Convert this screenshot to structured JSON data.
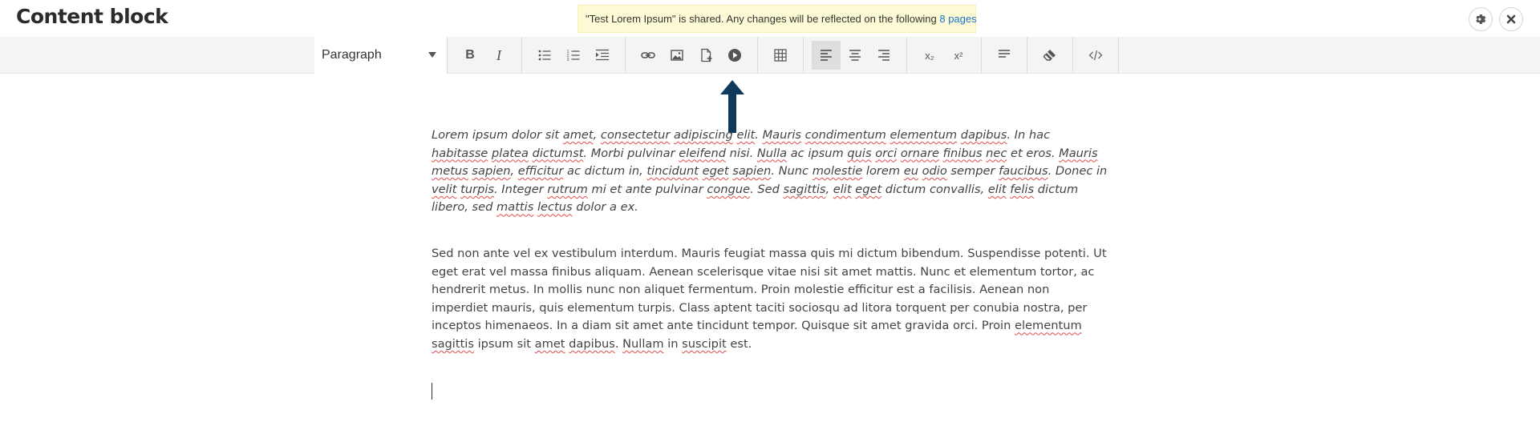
{
  "page": {
    "title": "Content block"
  },
  "notice": {
    "text": "\"Test Lorem Ipsum\" is shared. Any changes will be reflected on the following",
    "link": "8 pages"
  },
  "header_actions": {
    "settings_icon": "gear-icon",
    "close_icon": "close-icon"
  },
  "toolbar": {
    "block_format": "Paragraph",
    "bold_label": "B",
    "italic_label": "I",
    "subscript_label": "x₂",
    "superscript_label": "x²",
    "buttons": [
      "bold",
      "italic",
      "bullet-list",
      "numbered-list",
      "indent",
      "link",
      "image",
      "insert-file",
      "media",
      "table",
      "align-left",
      "align-center",
      "align-right",
      "subscript",
      "superscript",
      "paragraph",
      "clear-format",
      "source-code"
    ],
    "active_button": "align-left"
  },
  "colors": {
    "notice_bg": "#fdfbd5",
    "link": "#1a73c7",
    "arrow": "#0d3a5c",
    "spell_error": "#e14b4b"
  },
  "content": {
    "p1": [
      {
        "t": "Lorem ipsum dolor sit "
      },
      {
        "t": "amet",
        "s": 1
      },
      {
        "t": ", "
      },
      {
        "t": "consectetur",
        "s": 1
      },
      {
        "t": " "
      },
      {
        "t": "adipiscing",
        "s": 1
      },
      {
        "t": " "
      },
      {
        "t": "elit",
        "s": 1
      },
      {
        "t": ". "
      },
      {
        "t": "Mauris",
        "s": 1
      },
      {
        "t": " "
      },
      {
        "t": "condimentum",
        "s": 1
      },
      {
        "t": " "
      },
      {
        "t": "elementum",
        "s": 1
      },
      {
        "t": " "
      },
      {
        "t": "dapibus",
        "s": 1
      },
      {
        "t": ". In hac "
      },
      {
        "t": "habitasse",
        "s": 1
      },
      {
        "t": " "
      },
      {
        "t": "platea",
        "s": 1
      },
      {
        "t": " "
      },
      {
        "t": "dictumst",
        "s": 1
      },
      {
        "t": ". Morbi pulvinar "
      },
      {
        "t": "eleifend",
        "s": 1
      },
      {
        "t": " nisi. "
      },
      {
        "t": "Nulla",
        "s": 1
      },
      {
        "t": " ac ipsum "
      },
      {
        "t": "quis",
        "s": 1
      },
      {
        "t": " "
      },
      {
        "t": "orci",
        "s": 1
      },
      {
        "t": " "
      },
      {
        "t": "ornare",
        "s": 1
      },
      {
        "t": " "
      },
      {
        "t": "finibus",
        "s": 1
      },
      {
        "t": " "
      },
      {
        "t": "nec",
        "s": 1
      },
      {
        "t": " et eros. "
      },
      {
        "t": "Mauris",
        "s": 1
      },
      {
        "t": " "
      },
      {
        "t": "metus",
        "s": 1
      },
      {
        "t": " "
      },
      {
        "t": "sapien",
        "s": 1
      },
      {
        "t": ", "
      },
      {
        "t": "efficitur",
        "s": 1
      },
      {
        "t": " ac dictum in, "
      },
      {
        "t": "tincidunt",
        "s": 1
      },
      {
        "t": " "
      },
      {
        "t": "eget",
        "s": 1
      },
      {
        "t": " "
      },
      {
        "t": "sapien",
        "s": 1
      },
      {
        "t": ". Nunc "
      },
      {
        "t": "molestie",
        "s": 1
      },
      {
        "t": " lorem "
      },
      {
        "t": "eu",
        "s": 1
      },
      {
        "t": " "
      },
      {
        "t": "odio",
        "s": 1
      },
      {
        "t": " semper "
      },
      {
        "t": "faucibus",
        "s": 1
      },
      {
        "t": ". Donec in "
      },
      {
        "t": "velit",
        "s": 1
      },
      {
        "t": " "
      },
      {
        "t": "turpis",
        "s": 1
      },
      {
        "t": ". Integer "
      },
      {
        "t": "rutrum",
        "s": 1
      },
      {
        "t": " mi et ante pulvinar "
      },
      {
        "t": "congue",
        "s": 1
      },
      {
        "t": ". Sed "
      },
      {
        "t": "sagittis",
        "s": 1
      },
      {
        "t": ", "
      },
      {
        "t": "elit",
        "s": 1
      },
      {
        "t": " "
      },
      {
        "t": "eget",
        "s": 1
      },
      {
        "t": " dictum convallis, "
      },
      {
        "t": "elit",
        "s": 1
      },
      {
        "t": " "
      },
      {
        "t": "felis",
        "s": 1
      },
      {
        "t": " dictum libero, sed "
      },
      {
        "t": "mattis",
        "s": 1
      },
      {
        "t": " "
      },
      {
        "t": "lectus",
        "s": 1
      },
      {
        "t": " dolor a ex."
      }
    ],
    "p2": [
      {
        "t": "Sed non ante vel ex vestibulum interdum. Mauris feugiat massa quis mi dictum bibendum. Suspendisse potenti. Ut eget erat vel massa finibus aliquam. Aenean scelerisque vitae nisi sit amet mattis. Nunc et elementum tortor, ac hendrerit metus. In mollis nunc non aliquet fermentum. Proin molestie efficitur est a facilisis. Aenean non imperdiet mauris, quis elementum turpis. Class aptent taciti sociosqu ad litora torquent per conubia nostra, per inceptos himenaeos. In a diam sit amet ante tincidunt tempor. Quisque sit amet gravida orci. Proin "
      },
      {
        "t": "elementum",
        "s": 1
      },
      {
        "t": " "
      },
      {
        "t": "sagittis",
        "s": 1
      },
      {
        "t": " ipsum sit "
      },
      {
        "t": "amet",
        "s": 1
      },
      {
        "t": " "
      },
      {
        "t": "dapibus",
        "s": 1
      },
      {
        "t": ". "
      },
      {
        "t": "Nullam",
        "s": 1
      },
      {
        "t": " in "
      },
      {
        "t": "suscipit",
        "s": 1
      },
      {
        "t": " est."
      }
    ]
  }
}
